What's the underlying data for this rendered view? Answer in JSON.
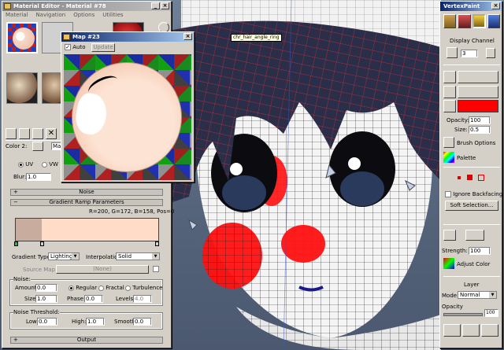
{
  "viewport": {
    "tooltip": "chr_hair_angle_ring"
  },
  "material_editor": {
    "title": "Material Editor - Material #78",
    "menu": [
      "Material",
      "Navigation",
      "Options",
      "Utilities"
    ],
    "color_label": "Color 2:",
    "map_field": "Ma",
    "uv_label": "UV",
    "vw_label": "VW",
    "blur_label": "Blur:",
    "blur_value": "1.0",
    "noise_rollout": "Noise",
    "gradient_rollout": "Gradient Ramp Parameters",
    "rgb_readout": "R=200, G=172, B=158, Pos=0",
    "gradient_type_label": "Gradient Type:",
    "gradient_type_value": "Lighting",
    "interpolation_label": "Interpolation:",
    "interpolation_value": "Solid",
    "source_map_label": "Source Map:",
    "source_map_value": "(None)",
    "noise_group": "Noise:",
    "amount_label": "Amount:",
    "amount_value": "0.0",
    "regular_label": "Regular",
    "fractal_label": "Fractal",
    "turbulence_label": "Turbulence",
    "size_label": "Size:",
    "size_value": "1.0",
    "phase_label": "Phase:",
    "phase_value": "0.0",
    "levels_label": "Levels:",
    "levels_value": "4.0",
    "threshold_group": "Noise Threshold:",
    "low_label": "Low:",
    "low_value": "0.0",
    "high_label": "High:",
    "high_value": "1.0",
    "smooth_label": "Smooth:",
    "smooth_value": "0.0",
    "output_rollout": "Output",
    "colors": {
      "gradient_left": "#c8ac9e",
      "gradient_right": "#ffdcc8"
    }
  },
  "map_window": {
    "title": "Map #23",
    "auto_label": "Auto",
    "update_label": "Update"
  },
  "vertex_paint": {
    "title": "VertexPaint",
    "display_channel_label": "Display Channel",
    "channel_value": "3",
    "opacity_label": "Opacity:",
    "opacity_value": "100",
    "size_label": "Size:",
    "size_value": "0.5",
    "brush_options_label": "Brush Options",
    "palette_label": "Palette",
    "ignore_backfacing_label": "Ignore Backfacing",
    "soft_selection_label": "Soft Selection...",
    "strength_label": "Strength:",
    "strength_value": "100",
    "adjust_color_label": "Adjust Color",
    "layer_label": "Layer",
    "mode_label": "Mode:",
    "mode_value": "Normal",
    "opacity2_label": "Opacity",
    "opacity2_value": "100",
    "colors": {
      "paint_color": "#ff0000"
    }
  }
}
